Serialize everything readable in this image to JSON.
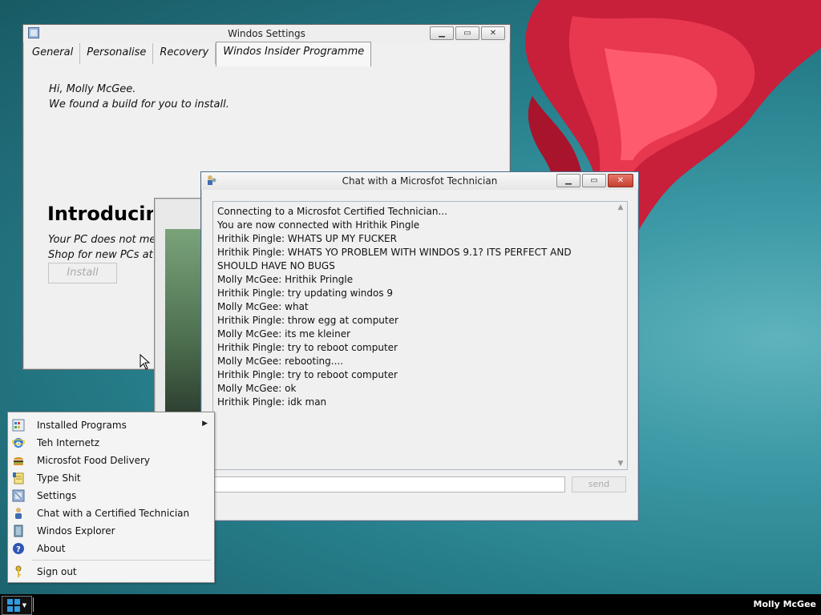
{
  "settings_window": {
    "title": "Windos Settings",
    "tabs": [
      "General",
      "Personalise",
      "Recovery",
      "Windos Insider Programme"
    ],
    "greeting": "Hi, Molly McGee.",
    "message": "We found a build for you to install.",
    "heading": "Introducing",
    "line1": "Your PC does not mee",
    "line2": "Shop for new PCs at n",
    "install_label": "Install"
  },
  "chat_window": {
    "title": "Chat with a Microsfot Technician",
    "messages": [
      "Connecting to a Microsfot Certified Technician...",
      "You are now connected with Hrithik Pingle",
      "Hrithik Pingle: WHATS UP MY FUCKER",
      "Hrithik Pingle: WHATS YO PROBLEM WITH WINDOS 9.1? ITS PERFECT AND SHOULD HAVE NO BUGS",
      "Molly McGee: Hrithik Pringle",
      "Hrithik Pingle: try updating windos 9",
      "Molly McGee: what",
      "Hrithik Pingle: throw egg at computer",
      "Molly McGee: its me kleiner",
      "Hrithik Pingle: try to reboot computer",
      "Molly McGee: rebooting....",
      "Hrithik Pingle: try to reboot computer",
      "Molly McGee: ok",
      "Hrithik Pingle: idk man"
    ],
    "input_value": "",
    "send_label": "send"
  },
  "start_menu": {
    "items": [
      {
        "label": "Installed Programs",
        "icon": "programs-icon",
        "submenu": true
      },
      {
        "label": "Teh Internetz",
        "icon": "internet-explorer-icon"
      },
      {
        "label": "Microsfot Food Delivery",
        "icon": "burger-icon"
      },
      {
        "label": "Type Shit",
        "icon": "notepad-icon"
      },
      {
        "label": "Settings",
        "icon": "settings-icon"
      },
      {
        "label": "Chat with a Certified Technician",
        "icon": "technician-icon"
      },
      {
        "label": "Windos Explorer",
        "icon": "explorer-icon"
      },
      {
        "label": "About",
        "icon": "help-icon"
      }
    ],
    "signout_label": "Sign out"
  },
  "taskbar": {
    "username": "Molly McGee"
  },
  "colors": {
    "desktop": "#277f8c",
    "window_bg": "#f0f0f0",
    "close_button": "#c4402f",
    "taskbar": "#000000"
  }
}
